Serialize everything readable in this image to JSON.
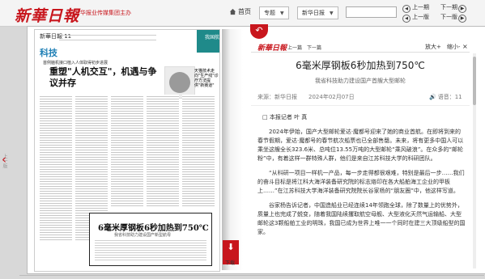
{
  "header": {
    "logo": "新華日報",
    "logo_sub": "新华报业传媒集团主办",
    "home": "首页",
    "column_select": "专题",
    "paper_select": "新华日报",
    "nav": {
      "prev_issue": "上一期",
      "next_issue": "下一期",
      "prev_page": "上一版",
      "next_page": "下一版"
    }
  },
  "side": {
    "prev_label": "上一版"
  },
  "newspaper": {
    "masthead": "新華日報 11",
    "section": "科技",
    "intro": "首例脑机接口植入人体取得初步进展",
    "headline": "重塑\"人机交互\"，机遇与争议并存",
    "ad": "我国航天人才",
    "caption": "天猫技术走向\"生产线\"诊疗方法提供\"新赛道\"",
    "boxed_title": "6毫米厚钢板6秒加热到750℃",
    "boxed_sub": "我省科技助力建设国产新型航母"
  },
  "pdf": {
    "label": "下载"
  },
  "article": {
    "logo": "新華日報",
    "nav": "上一篇　下一篇",
    "zoom_in": "放大+",
    "zoom_out": "缩小-",
    "close": "×",
    "title": "6毫米厚钢板6秒加热到750℃",
    "subtitle": "我省科技助力建设国产首艘大型邮轮",
    "source": "来源：新华日报",
    "date": "2024年02月07日",
    "audio": "语音：11",
    "paragraphs": [
      "□ 本报记者 叶 真",
      "2024年伊始，国产大型邮轮爱达·魔都号迎来了她的商业首航。在即将到来的春节假期，爱达·魔都号的春节航次船票也已全部售罄。未来，将有更多中国人可以乘坐这艘全长323.6米、总吨位13.55万吨的大型邮轮“乘风破浪”。在众多的“邮轮粉”中，有着这样一群特殊人群，他们是来自江苏科技大学的科研团队。",
      "“从科研一项目一样机一产品，每一步走得都很艰难，特别是最后一步……我们的奋斗目标是将江科大海洋装备研究院的标志烙印在各大船舶海工企业的甲板上……”在江苏科技大学海洋装备研究院院长谷家杨的“朋友圈”中，他这样写道。",
      "谷家杨告诉记者，中国造船业已经连续14年领跑全球，除了数量上的优势外，质量上也完成了蜕变，随着我国陆续攫取航空母舰、大型液化天然气运输船、大型邮轮这3颗船舶工业的明珠，我国已成为世界上唯一一个同时在建三大顶级船型的国家。"
    ]
  }
}
